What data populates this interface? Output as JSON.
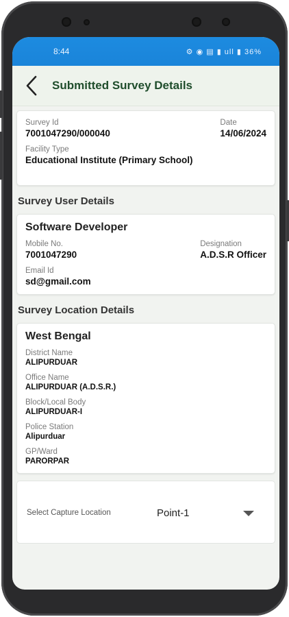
{
  "status_bar": {
    "time": "8:44",
    "icons_text": "⚙ ◉ ▤ ▮ ull ▮ 36%"
  },
  "app_bar": {
    "title": "Submitted Survey Details"
  },
  "survey": {
    "survey_id_label": "Survey Id",
    "survey_id": "7001047290/000040",
    "date_label": "Date",
    "date": "14/06/2024",
    "facility_type_label": "Facility Type",
    "facility_type": "Educational Institute (Primary School)"
  },
  "user_section": {
    "heading": "Survey User Details",
    "name": "Software Developer",
    "mobile_label": "Mobile No.",
    "mobile": "7001047290",
    "designation_label": "Designation",
    "designation": "A.D.S.R Officer",
    "email_label": "Email Id",
    "email": "sd@gmail.com"
  },
  "location_section": {
    "heading": "Survey Location Details",
    "state": "West Bengal",
    "district_label": "District Name",
    "district": "ALIPURDUAR",
    "office_label": "Office Name",
    "office": "ALIPURDUAR (A.D.S.R.)",
    "block_label": "Block/Local Body",
    "block": "ALIPURDUAR-I",
    "police_label": "Police Station",
    "police": "Alipurduar",
    "gp_label": "GP/Ward",
    "gp": "PARORPAR"
  },
  "capture": {
    "label": "Select Capture Location",
    "value": "Point-1"
  }
}
